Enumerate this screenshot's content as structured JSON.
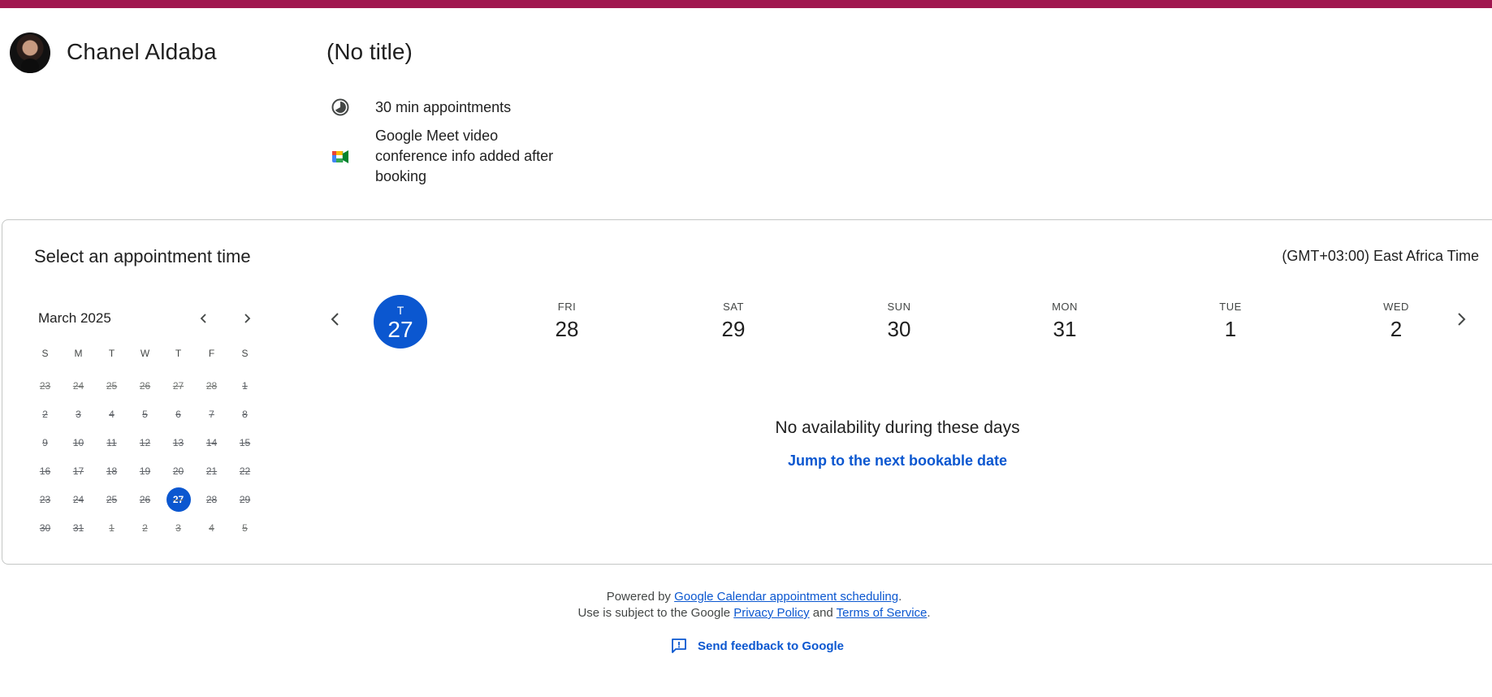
{
  "host": {
    "name": "Chanel Aldaba"
  },
  "event": {
    "title": "(No title)",
    "duration": "30 min appointments",
    "conference_lines": [
      "Google Meet video",
      "conference info added after",
      "booking"
    ]
  },
  "booking": {
    "heading": "Select an appointment time",
    "timezone": "(GMT+03:00) East Africa Time"
  },
  "mini_calendar": {
    "month_label": "March 2025",
    "prev_icon": "chevron-left-icon",
    "next_icon": "chevron-right-icon",
    "weekday_headers": [
      "S",
      "M",
      "T",
      "W",
      "T",
      "F",
      "S"
    ],
    "weeks": [
      [
        "23",
        "24",
        "25",
        "26",
        "27",
        "28",
        "1"
      ],
      [
        "2",
        "3",
        "4",
        "5",
        "6",
        "7",
        "8"
      ],
      [
        "9",
        "10",
        "11",
        "12",
        "13",
        "14",
        "15"
      ],
      [
        "16",
        "17",
        "18",
        "19",
        "20",
        "21",
        "22"
      ],
      [
        "23",
        "24",
        "25",
        "26",
        "27",
        "28",
        "29"
      ],
      [
        "30",
        "31",
        "1",
        "2",
        "3",
        "4",
        "5"
      ]
    ],
    "selected_day": "27"
  },
  "week_view": {
    "days": [
      {
        "dow": "T",
        "num": "27",
        "selected": true
      },
      {
        "dow": "FRI",
        "num": "28"
      },
      {
        "dow": "SAT",
        "num": "29"
      },
      {
        "dow": "SUN",
        "num": "30"
      },
      {
        "dow": "MON",
        "num": "31"
      },
      {
        "dow": "TUE",
        "num": "1"
      },
      {
        "dow": "WED",
        "num": "2"
      }
    ],
    "empty_message": "No availability during these days",
    "jump_link": "Jump to the next bookable date"
  },
  "footer": {
    "powered_prefix": "Powered by ",
    "powered_link": "Google Calendar appointment scheduling",
    "powered_suffix": ".",
    "terms_prefix": "Use is subject to the Google ",
    "privacy_link": "Privacy Policy",
    "and_text": " and ",
    "terms_link": "Terms of Service",
    "terms_suffix": ".",
    "feedback_label": "Send feedback to Google",
    "feedback_icon": "feedback-icon"
  },
  "colors": {
    "accent": "#0b57d0",
    "top_bar": "#a0174f"
  }
}
